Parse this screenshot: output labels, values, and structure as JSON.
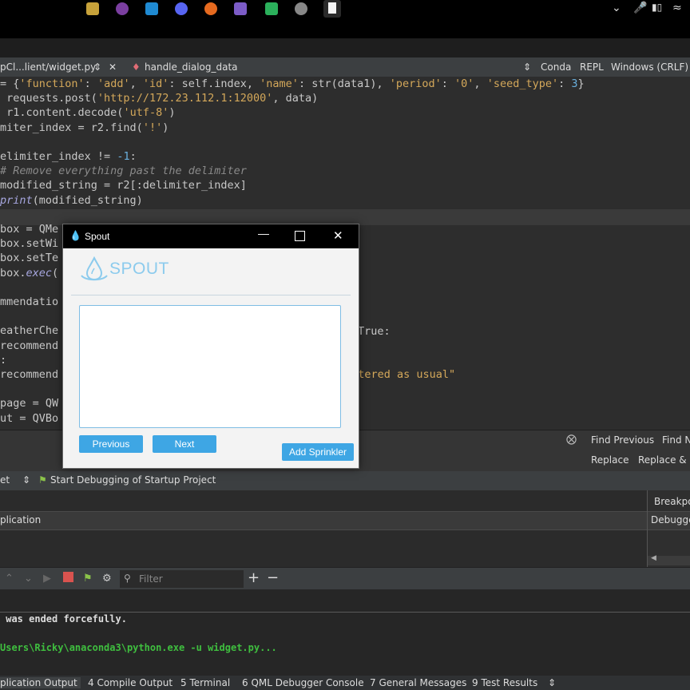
{
  "editor_tab": {
    "file_label": "pCl...lient/widget.py",
    "function_label": "handle_dialog_data",
    "conda": "Conda",
    "repl": "REPL",
    "line_endings": "Windows (CRLF)"
  },
  "code_lines": [
    {
      "t": "",
      "parts": [
        [
          "= {",
          ""
        ],
        [
          "'function'",
          "str"
        ],
        [
          ": ",
          ""
        ],
        [
          "'add'",
          "str"
        ],
        [
          ", ",
          ""
        ],
        [
          "'id'",
          "str"
        ],
        [
          ": self.index, ",
          ""
        ],
        [
          "'name'",
          "str"
        ],
        [
          ": str(data1), ",
          ""
        ],
        [
          "'period'",
          "str"
        ],
        [
          ": ",
          ""
        ],
        [
          "'0'",
          "str"
        ],
        [
          ", ",
          ""
        ],
        [
          "'seed_type'",
          "str"
        ],
        [
          ": ",
          ""
        ],
        [
          "3",
          "num"
        ],
        [
          "}",
          ""
        ]
      ]
    },
    {
      "parts": [
        [
          " requests.post(",
          ""
        ],
        [
          "'http://172.23.112.1:12000'",
          "str"
        ],
        [
          ", data)",
          ""
        ]
      ]
    },
    {
      "parts": [
        [
          " r1.content.decode(",
          ""
        ],
        [
          "'utf-8'",
          "str"
        ],
        [
          ")",
          ""
        ]
      ]
    },
    {
      "parts": [
        [
          "miter_index = r2.find(",
          ""
        ],
        [
          "'!'",
          "str"
        ],
        [
          ")",
          ""
        ]
      ]
    },
    {
      "parts": [
        [
          "",
          ""
        ]
      ]
    },
    {
      "parts": [
        [
          "elimiter_index != ",
          ""
        ],
        [
          "-1",
          "num"
        ],
        [
          ":",
          ""
        ]
      ]
    },
    {
      "parts": [
        [
          "# Remove everything past the delimiter",
          "cmt"
        ]
      ]
    },
    {
      "parts": [
        [
          "modified_string = r2[:delimiter_index]",
          ""
        ]
      ]
    },
    {
      "parts": [
        [
          "print",
          "fn"
        ],
        [
          "(modified_string)",
          ""
        ]
      ]
    },
    {
      "parts": [
        [
          "",
          ""
        ]
      ]
    },
    {
      "parts": [
        [
          "box = QMe",
          ""
        ]
      ]
    },
    {
      "parts": [
        [
          "box.setWi",
          ""
        ]
      ]
    },
    {
      "parts": [
        [
          "box.setTe",
          ""
        ]
      ]
    },
    {
      "parts": [
        [
          "box.",
          ""
        ],
        [
          "exec",
          "fn"
        ],
        [
          "(",
          ""
        ]
      ]
    },
    {
      "parts": [
        [
          "",
          ""
        ]
      ]
    },
    {
      "parts": [
        [
          "mmendatio",
          ""
        ]
      ]
    },
    {
      "parts": [
        [
          "",
          ""
        ]
      ]
    },
    {
      "parts": [
        [
          "eatherChe",
          ""
        ]
      ]
    },
    {
      "parts": [
        [
          "recommend",
          ""
        ]
      ]
    },
    {
      "parts": [
        [
          ":",
          ""
        ]
      ]
    },
    {
      "parts": [
        [
          "recommend",
          ""
        ]
      ]
    },
    {
      "parts": [
        [
          "",
          ""
        ]
      ]
    },
    {
      "parts": [
        [
          "page = QW",
          ""
        ]
      ]
    },
    {
      "parts": [
        [
          "ut = QVBo",
          ""
        ]
      ]
    }
  ],
  "code_fragments": {
    "true_fragment": "True:",
    "watered_fragment": "watered as usual\""
  },
  "find_panel": {
    "find_previous": "Find Previous",
    "find_next": "Find N",
    "replace": "Replace",
    "replace_find": "Replace & F"
  },
  "debug_toolbar": {
    "left_item": "et",
    "start_debugging": "Start Debugging of Startup Project"
  },
  "debug_panel": {
    "application_header": "plication",
    "breakpoints": "Breakpoi",
    "debugger": "Debugge"
  },
  "output_toolbar": {
    "filter_placeholder": "Filter",
    "add": "+",
    "remove": "−"
  },
  "output_lines": {
    "line1": " was ended forcefully.",
    "line2": "Users\\Ricky\\anaconda3\\python.exe -u widget.py..."
  },
  "bottom_tabs": [
    "plication Output",
    "4  Compile Output",
    "5  Terminal",
    "6  QML Debugger Console",
    "7  General Messages",
    "9  Test Results"
  ],
  "dialog": {
    "title": "Spout",
    "logo_text": "SPOUT",
    "previous_label": "Previous",
    "next_label": "Next",
    "add_sprinkler_label": "Add Sprinkler",
    "accent_color": "#3ea6e4"
  }
}
